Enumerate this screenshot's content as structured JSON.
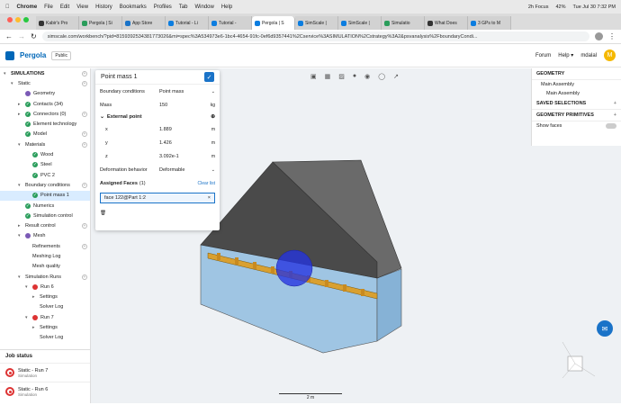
{
  "mac": {
    "app": "Chrome",
    "menu": [
      "File",
      "Edit",
      "View",
      "History",
      "Bookmarks",
      "Profiles",
      "Tab",
      "Window",
      "Help"
    ],
    "focus": "2h Focus",
    "battery": "42%",
    "datetime": "Tue Jul 30  7:32 PM"
  },
  "tabs": [
    "Kabir's Pro",
    "Pergola | Si",
    "App Store",
    "Tutorial - Li",
    "Tutorial -",
    "Pergola | S",
    "SimScale |",
    "SimScale |",
    "Simulatio",
    "What Does",
    "3 GPs to M"
  ],
  "url": "simscale.com/workbench/?pid=81593925343817730​26&mi=spec%3A5349​73e6-1bc4-4654-91fc-0ef6d9357441%2Cservice%3ASIMULATION%2Cstrategy%3A2&psvanalysis%2FboundaryCondi...",
  "app": {
    "logo": "Pergola",
    "public": "Public",
    "forum": "Forum",
    "help": "Help ▾",
    "user": "mdalal",
    "avatar": "M"
  },
  "tree": [
    {
      "l": "SIMULATIONS",
      "i": 0,
      "t": "▾",
      "b": 1,
      "p": 1
    },
    {
      "l": "Static",
      "i": 1,
      "t": "▾",
      "p": 1
    },
    {
      "l": "Geometry",
      "i": 2,
      "ic": "geo"
    },
    {
      "l": "Contacts (34)",
      "i": 2,
      "ic": "chk",
      "t": "▸"
    },
    {
      "l": "Connectors (0)",
      "i": 2,
      "ic": "chk",
      "t": "▸",
      "p": 1
    },
    {
      "l": "Element technology",
      "i": 2,
      "ic": "chk"
    },
    {
      "l": "Model",
      "i": 2,
      "ic": "chk",
      "p": 1
    },
    {
      "l": "Materials",
      "i": 2,
      "t": "▾",
      "p": 1
    },
    {
      "l": "Wood",
      "i": 3,
      "ic": "chk"
    },
    {
      "l": "Steel",
      "i": 3,
      "ic": "chk"
    },
    {
      "l": "PVC 2",
      "i": 3,
      "ic": "chk"
    },
    {
      "l": "Boundary conditions",
      "i": 2,
      "t": "▾",
      "p": 1
    },
    {
      "l": "Point mass 1",
      "i": 3,
      "ic": "chk",
      "s": 1
    },
    {
      "l": "Numerics",
      "i": 2,
      "ic": "chk"
    },
    {
      "l": "Simulation control",
      "i": 2,
      "ic": "chk"
    },
    {
      "l": "Result control",
      "i": 2,
      "t": "▸",
      "p": 1
    },
    {
      "l": "Mesh",
      "i": 2,
      "ic": "geo",
      "t": "▾"
    },
    {
      "l": "Refinements",
      "i": 3,
      "p": 1
    },
    {
      "l": "Meshing Log",
      "i": 3
    },
    {
      "l": "Mesh quality",
      "i": 3
    },
    {
      "l": "Simulation Runs",
      "i": 2,
      "t": "▾",
      "p": 1
    },
    {
      "l": "Run 6",
      "i": 3,
      "ic": "run",
      "t": "▾"
    },
    {
      "l": "Settings",
      "i": 4,
      "t": "▸"
    },
    {
      "l": "Solver Log",
      "i": 4
    },
    {
      "l": "Run 7",
      "i": 3,
      "ic": "run",
      "t": "▾"
    },
    {
      "l": "Settings",
      "i": 4,
      "t": "▸"
    },
    {
      "l": "Solver Log",
      "i": 4
    }
  ],
  "job": {
    "title": "Job status",
    "items": [
      {
        "name": "Static - Run 7",
        "sub": "Simulation"
      },
      {
        "name": "Static - Run 6",
        "sub": "Simulation"
      }
    ]
  },
  "panel": {
    "title": "Point mass 1",
    "bc_label": "Boundary conditions",
    "bc_value": "Point mass",
    "mass_label": "Mass",
    "mass_value": "150",
    "mass_unit": "kg",
    "ext": "External point",
    "x": "1.889",
    "y": "1.426",
    "z": "3.092e-1",
    "unit": "m",
    "def_label": "Deformation behavior",
    "def_value": "Deformable",
    "faces_label": "Assigned Faces",
    "faces_count": "(1)",
    "clear": "Clear list",
    "face": "face 122@Part 1:2"
  },
  "right": {
    "geometry": "GEOMETRY",
    "main1": "Main Assembly",
    "main2": "Main Assembly",
    "saved": "SAVED SELECTIONS",
    "prims": "GEOMETRY PRIMITIVES",
    "show_faces": "Show faces"
  },
  "scale": "2 m"
}
